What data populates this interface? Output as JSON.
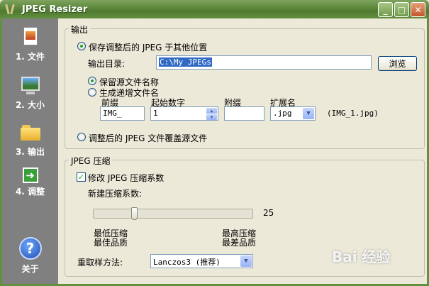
{
  "window": {
    "title": "JPEG Resizer",
    "min": "_",
    "max": "□",
    "close": "✕"
  },
  "sidebar": {
    "items": [
      {
        "label": "1. 文件",
        "icon": "file-icon"
      },
      {
        "label": "2. 大小",
        "icon": "size-icon"
      },
      {
        "label": "3. 输出",
        "icon": "output-folder-icon"
      },
      {
        "label": "4. 调整",
        "icon": "adjust-arrow-icon"
      },
      {
        "label": "关于",
        "icon": "help-icon"
      }
    ],
    "adjust_glyph": "➜",
    "about_glyph": "?"
  },
  "output": {
    "group_title": "输出",
    "save_other_label": "保存调整后的 JPEG 于其他位置",
    "dir_label": "输出目录:",
    "dir_value": "C:\\My JPEGs",
    "browse_label": "浏览",
    "keep_name_label": "保留源文件名称",
    "gen_name_label": "生成递增文件名",
    "prefix_label": "前缀",
    "start_label": "起始数字",
    "suffix_label": "附缀",
    "ext_label": "扩展名",
    "prefix_value": "IMG_",
    "start_value": "1",
    "suffix_value": "",
    "ext_value": ".jpg",
    "example": "(IMG_1.jpg)",
    "overwrite_label": "调整后的 JPEG 文件覆盖源文件"
  },
  "compression": {
    "group_title": "JPEG 压缩",
    "modify_label": "修改 JPEG 压缩系数",
    "new_label": "新建压缩系数:",
    "value": "25",
    "value_fraction": 0.25,
    "min_label_1": "最低压缩",
    "min_label_2": "最佳品质",
    "max_label_1": "最高压缩",
    "max_label_2": "最差品质",
    "resample_label": "重取样方法:",
    "resample_value": "Lanczos3 (推荐)"
  },
  "watermark": "Bai 经验"
}
